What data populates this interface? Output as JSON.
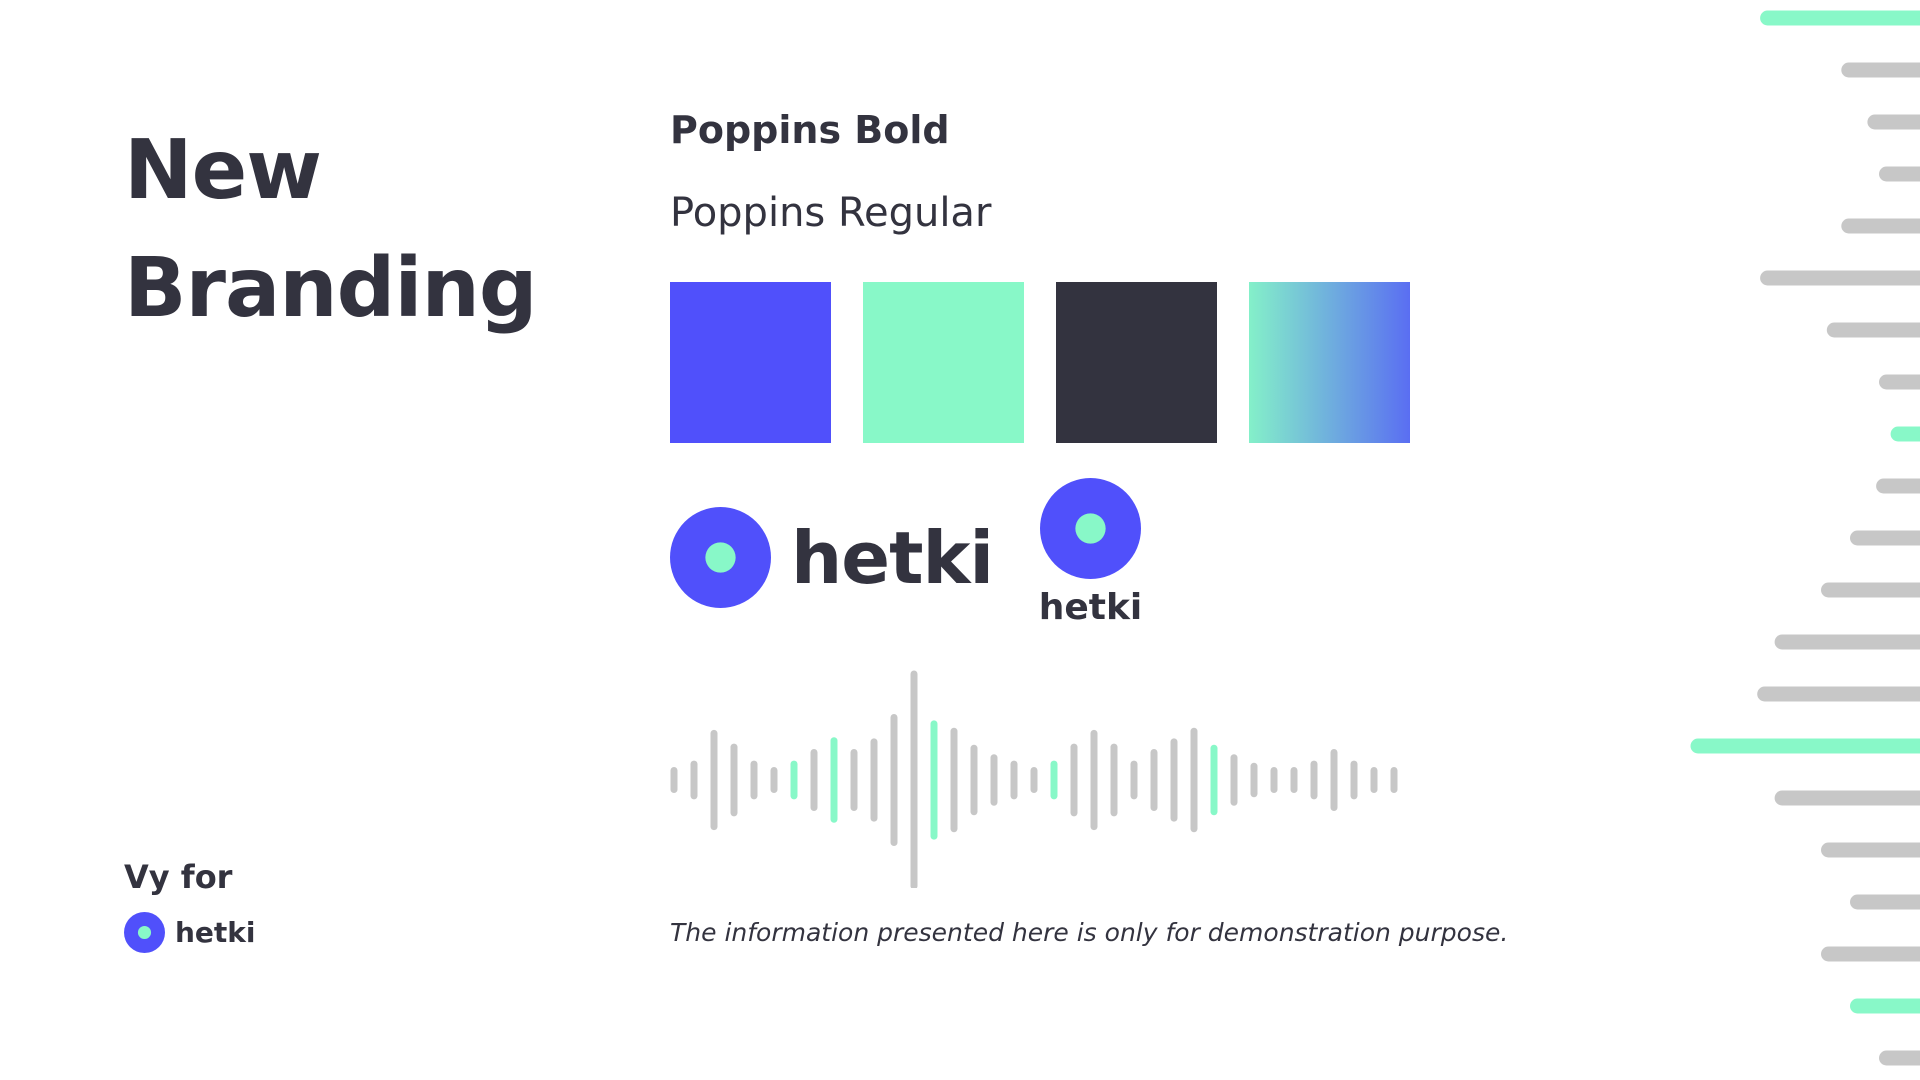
{
  "title": {
    "line1": "New",
    "line2": "Branding"
  },
  "typography": {
    "bold_sample": "Poppins Bold",
    "regular_sample": "Poppins Regular"
  },
  "palette": [
    {
      "name": "blue",
      "color": "#5050fb"
    },
    {
      "name": "mint",
      "color": "#88f8c8"
    },
    {
      "name": "dark",
      "color": "#33333f"
    },
    {
      "name": "gradient",
      "from": "#84f0c9",
      "to": "#5a6ef2"
    }
  ],
  "brand": {
    "name": "hetki",
    "mark_outer_color": "#5050fb",
    "mark_inner_color": "#88f8c8"
  },
  "credit": {
    "label": "Vy for",
    "brand_name": "hetki"
  },
  "waveform": {
    "bar_color": "#c7c7c7",
    "accent_color": "#88f8c8",
    "heights": [
      0.09,
      0.15,
      0.44,
      0.31,
      0.15,
      0.09,
      0.15,
      0.26,
      0.37,
      0.26,
      0.36,
      0.59,
      1.0,
      0.53,
      0.46,
      0.3,
      0.21,
      0.15,
      0.09,
      0.15,
      0.31,
      0.44,
      0.31,
      0.15,
      0.26,
      0.36,
      0.46,
      0.3,
      0.21,
      0.13,
      0.09,
      0.09,
      0.15,
      0.26,
      0.15,
      0.09,
      0.09
    ],
    "accent_indices": [
      6,
      8,
      13,
      19,
      27
    ]
  },
  "disclaimer": "The information presented here is only for demonstration purpose.",
  "decorative_lines": {
    "gray": "#c7c7c7",
    "accent": "#88f8c8",
    "lengths": [
      0.56,
      0.28,
      0.19,
      0.15,
      0.28,
      0.56,
      0.33,
      0.15,
      0.11,
      0.16,
      0.25,
      0.35,
      0.51,
      0.57,
      0.8,
      0.51,
      0.35,
      0.25,
      0.35,
      0.25,
      0.15
    ],
    "accent_indices": [
      0,
      8,
      14,
      19
    ]
  }
}
